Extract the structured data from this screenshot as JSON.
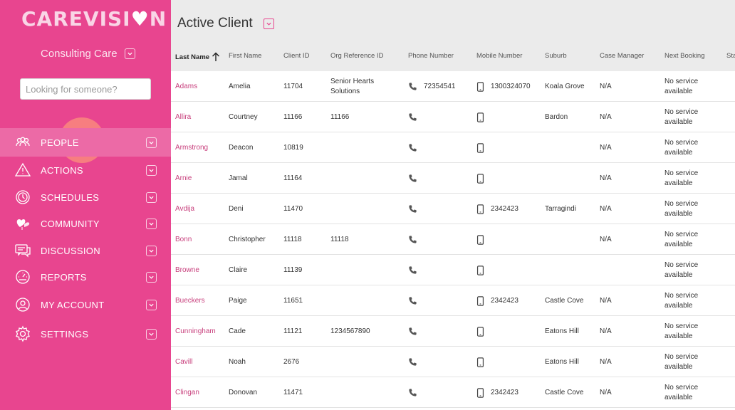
{
  "app": {
    "logo_text": "CAREVISI",
    "logo_tail": "N",
    "org_name": "Consulting Care",
    "search_placeholder": "Looking for someone?"
  },
  "nav": [
    {
      "label": "PEOPLE",
      "icon": "people-icon",
      "active": true
    },
    {
      "label": "ACTIONS",
      "icon": "warning-icon"
    },
    {
      "label": "SCHEDULES",
      "icon": "clock-icon"
    },
    {
      "label": "COMMUNITY",
      "icon": "hearts-icon"
    },
    {
      "label": "DISCUSSION",
      "icon": "chat-icon"
    },
    {
      "label": "REPORTS",
      "icon": "gauge-icon"
    },
    {
      "label": "MY ACCOUNT",
      "icon": "user-icon"
    },
    {
      "label": "SETTINGS",
      "icon": "gear-icon"
    }
  ],
  "page": {
    "title": "Active Client"
  },
  "table": {
    "headers": [
      "Last Name",
      "First Name",
      "Client ID",
      "Org Reference ID",
      "Phone Number",
      "Mobile Number",
      "Suburb",
      "Case Manager",
      "Next Booking",
      "Sta"
    ],
    "rows": [
      {
        "last": "Adams",
        "first": "Amelia",
        "id": "11704",
        "org_ref": "Senior Hearts Solutions",
        "phone": "72354541",
        "mobile": "1300324070",
        "suburb": "Koala Grove",
        "manager": "N/A",
        "booking": "No service available"
      },
      {
        "last": "Allira",
        "first": "Courtney",
        "id": "11166",
        "org_ref": "11166",
        "phone": "",
        "mobile": "",
        "suburb": "Bardon",
        "manager": "N/A",
        "booking": "No service available"
      },
      {
        "last": "Armstrong",
        "first": "Deacon",
        "id": "10819",
        "org_ref": "",
        "phone": "",
        "mobile": "",
        "suburb": "",
        "manager": "N/A",
        "booking": "No service available"
      },
      {
        "last": "Arnie",
        "first": "Jamal",
        "id": "11164",
        "org_ref": "",
        "phone": "",
        "mobile": "",
        "suburb": "",
        "manager": "N/A",
        "booking": "No service available"
      },
      {
        "last": "Avdija",
        "first": "Deni",
        "id": "11470",
        "org_ref": "",
        "phone": "",
        "mobile": "2342423",
        "suburb": "Tarragindi",
        "manager": "N/A",
        "booking": "No service available"
      },
      {
        "last": "Bonn",
        "first": "Christopher",
        "id": "11118",
        "org_ref": "11118",
        "phone": "",
        "mobile": "",
        "suburb": "",
        "manager": "N/A",
        "booking": "No service available"
      },
      {
        "last": "Browne",
        "first": "Claire",
        "id": "11139",
        "org_ref": "",
        "phone": "",
        "mobile": "",
        "suburb": "",
        "manager": "",
        "booking": "No service available"
      },
      {
        "last": "Bueckers",
        "first": "Paige",
        "id": "11651",
        "org_ref": "",
        "phone": "",
        "mobile": "2342423",
        "suburb": "Castle Cove",
        "manager": "N/A",
        "booking": "No service available"
      },
      {
        "last": "Cunningham",
        "first": "Cade",
        "id": "11121",
        "org_ref": "1234567890",
        "phone": "",
        "mobile": "",
        "suburb": "Eatons Hill",
        "manager": "N/A",
        "booking": "No service available"
      },
      {
        "last": "Cavill",
        "first": "Noah",
        "id": "2676",
        "org_ref": "",
        "phone": "",
        "mobile": "",
        "suburb": "Eatons Hill",
        "manager": "N/A",
        "booking": "No service available"
      },
      {
        "last": "Clingan",
        "first": "Donovan",
        "id": "11471",
        "org_ref": "",
        "phone": "",
        "mobile": "2342423",
        "suburb": "Castle Cove",
        "manager": "N/A",
        "booking": "No service available"
      }
    ]
  },
  "colors": {
    "sidebar": "#e8458f",
    "sidebar_active": "#ec6aa6",
    "link": "#c8407d"
  }
}
